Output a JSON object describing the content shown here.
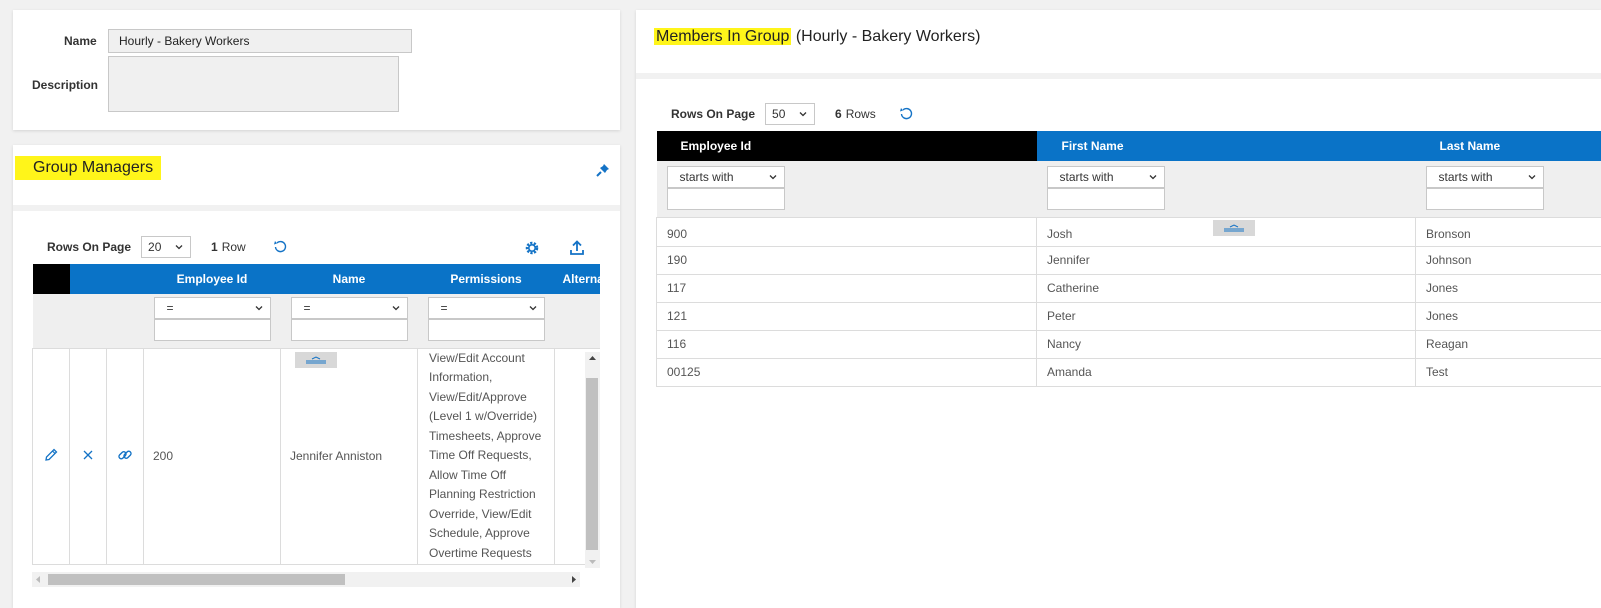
{
  "group_details": {
    "name_label": "Name",
    "name_value": "Hourly - Bakery Workers",
    "description_label": "Description",
    "description_value": ""
  },
  "group_managers": {
    "title": "Group Managers",
    "rows_on_page_label": "Rows On Page",
    "rows_on_page_value": "20",
    "row_count": "1",
    "row_count_label": "Row",
    "columns": [
      "Employee Id",
      "Name",
      "Permissions",
      "Alterna"
    ],
    "filters": [
      "=",
      "=",
      "="
    ],
    "rows": [
      {
        "employee_id": "200",
        "name": "Jennifer Anniston",
        "permissions": "View/Edit Account Information, View/Edit/Approve (Level 1 w/Override) Timesheets, Approve Time Off Requests, Allow Time Off Planning Restriction Override, View/Edit Schedule, Approve Overtime Requests"
      }
    ]
  },
  "members": {
    "title_highlight": "Members In Group",
    "title_rest": " (Hourly - Bakery Workers)",
    "rows_on_page_label": "Rows On Page",
    "rows_on_page_value": "50",
    "row_count": "6",
    "row_count_label": "Rows",
    "columns": [
      "Employee Id",
      "First Name",
      "Last Name"
    ],
    "filters": [
      "starts with",
      "starts with",
      "starts with"
    ],
    "rows": [
      {
        "employee_id": "900",
        "first_name": "Josh",
        "last_name": "Bronson"
      },
      {
        "employee_id": "190",
        "first_name": "Jennifer",
        "last_name": "Johnson"
      },
      {
        "employee_id": "117",
        "first_name": "Catherine",
        "last_name": "Jones"
      },
      {
        "employee_id": "121",
        "first_name": "Peter",
        "last_name": "Jones"
      },
      {
        "employee_id": "116",
        "first_name": "Nancy",
        "last_name": "Reagan"
      },
      {
        "employee_id": "00125",
        "first_name": "Amanda",
        "last_name": "Test"
      }
    ]
  },
  "colors": {
    "header_blue": "#0a73c7",
    "header_black": "#000000",
    "highlight_yellow": "#fff51a",
    "icon_blue": "#1473c6"
  }
}
